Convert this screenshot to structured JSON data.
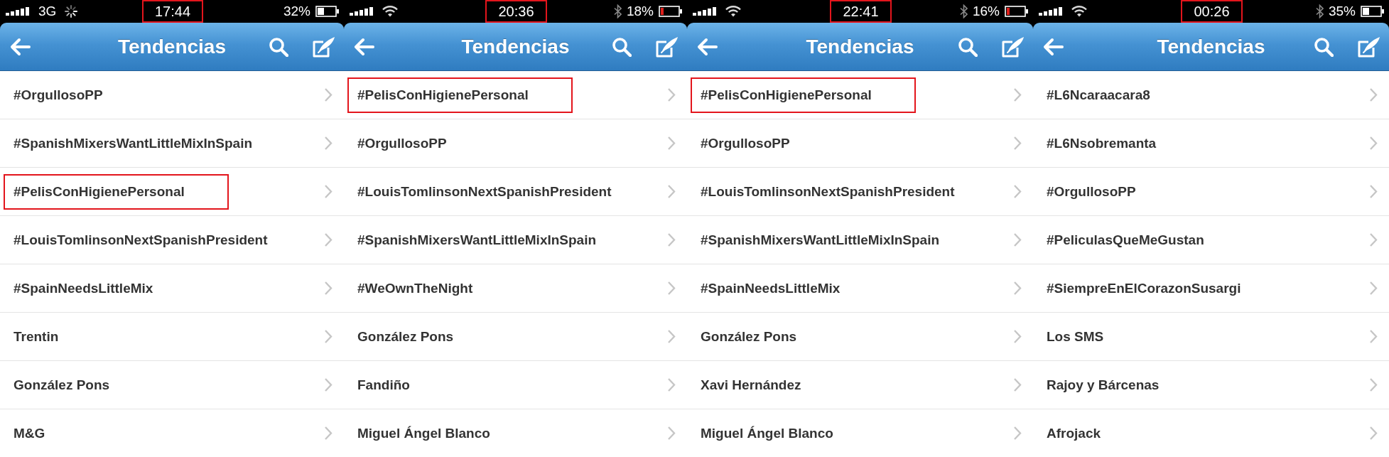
{
  "screens": [
    {
      "status_bar": {
        "connection": {
          "kind": "cellular",
          "label": "3G"
        },
        "loading": true,
        "time": "17:44",
        "time_highlighted": true,
        "bluetooth": false,
        "battery": "32%",
        "battery_low": false
      },
      "header": {
        "title": "Tendencias"
      },
      "trends": [
        {
          "label": "#OrgullosoPP",
          "highlighted": false
        },
        {
          "label": "#SpanishMixersWantLittleMixInSpain",
          "highlighted": false
        },
        {
          "label": "#PelisConHigienePersonal",
          "highlighted": true
        },
        {
          "label": "#LouisTomlinsonNextSpanishPresident",
          "highlighted": false
        },
        {
          "label": "#SpainNeedsLittleMix",
          "highlighted": false
        },
        {
          "label": "Trentin",
          "highlighted": false
        },
        {
          "label": "González Pons",
          "highlighted": false
        },
        {
          "label": "M&G",
          "highlighted": false
        }
      ]
    },
    {
      "status_bar": {
        "connection": {
          "kind": "wifi"
        },
        "loading": false,
        "time": "20:36",
        "time_highlighted": true,
        "bluetooth": true,
        "battery": "18%",
        "battery_low": true
      },
      "header": {
        "title": "Tendencias"
      },
      "trends": [
        {
          "label": "#PelisConHigienePersonal",
          "highlighted": true
        },
        {
          "label": "#OrgullosoPP",
          "highlighted": false
        },
        {
          "label": "#LouisTomlinsonNextSpanishPresident",
          "highlighted": false
        },
        {
          "label": "#SpanishMixersWantLittleMixInSpain",
          "highlighted": false
        },
        {
          "label": "#WeOwnTheNight",
          "highlighted": false
        },
        {
          "label": "González Pons",
          "highlighted": false
        },
        {
          "label": "Fandiño",
          "highlighted": false
        },
        {
          "label": "Miguel Ángel Blanco",
          "highlighted": false
        }
      ]
    },
    {
      "status_bar": {
        "connection": {
          "kind": "wifi"
        },
        "loading": false,
        "time": "22:41",
        "time_highlighted": true,
        "bluetooth": true,
        "battery": "16%",
        "battery_low": true
      },
      "header": {
        "title": "Tendencias"
      },
      "trends": [
        {
          "label": "#PelisConHigienePersonal",
          "highlighted": true
        },
        {
          "label": "#OrgullosoPP",
          "highlighted": false
        },
        {
          "label": "#LouisTomlinsonNextSpanishPresident",
          "highlighted": false
        },
        {
          "label": "#SpanishMixersWantLittleMixInSpain",
          "highlighted": false
        },
        {
          "label": "#SpainNeedsLittleMix",
          "highlighted": false
        },
        {
          "label": "González Pons",
          "highlighted": false
        },
        {
          "label": "Xavi Hernández",
          "highlighted": false
        },
        {
          "label": "Miguel Ángel Blanco",
          "highlighted": false
        }
      ]
    },
    {
      "status_bar": {
        "connection": {
          "kind": "wifi"
        },
        "loading": false,
        "time": "00:26",
        "time_highlighted": true,
        "bluetooth": true,
        "battery": "35%",
        "battery_low": false
      },
      "header": {
        "title": "Tendencias"
      },
      "trends": [
        {
          "label": "#L6Ncaraacara8",
          "highlighted": false
        },
        {
          "label": "#L6Nsobremanta",
          "highlighted": false
        },
        {
          "label": "#OrgullosoPP",
          "highlighted": false
        },
        {
          "label": "#PeliculasQueMeGustan",
          "highlighted": false
        },
        {
          "label": "#SiempreEnElCorazonSusargi",
          "highlighted": false
        },
        {
          "label": "Los SMS",
          "highlighted": false
        },
        {
          "label": "Rajoy y Bárcenas",
          "highlighted": false
        },
        {
          "label": "Afrojack",
          "highlighted": false
        }
      ]
    }
  ]
}
